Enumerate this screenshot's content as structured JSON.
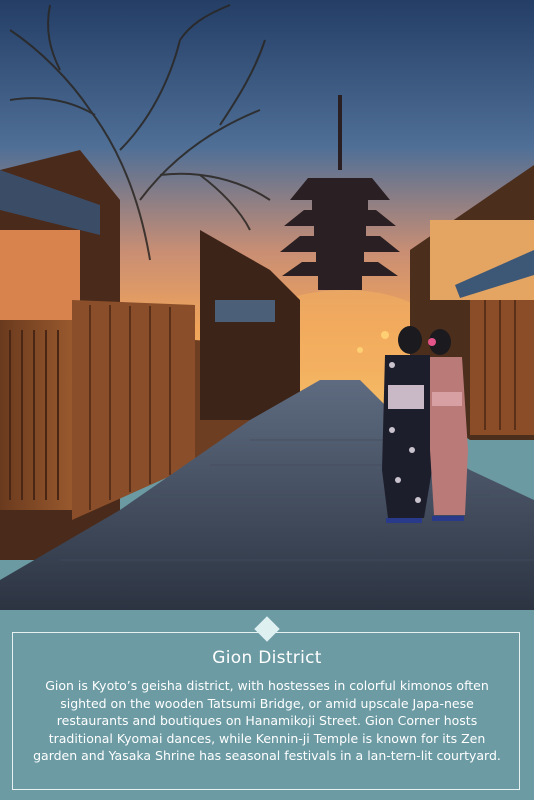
{
  "photo": {
    "subject": "Pagoda at dusk above a stone-paved lane lined with wooden houses; two women in kimonos stand on the street"
  },
  "decor": {
    "icon": "diamond-icon",
    "accent": "#dff0f1",
    "panel_color": "#6c9ba4"
  },
  "caption": {
    "title": "Gion District",
    "description": "Gion is Kyoto’s geisha district, with hostesses in colorful kimonos often sighted on the wooden Tatsumi Bridge, or amid upscale Japa-nese restaurants and boutiques on Hanamikoji Street. Gion Corner hosts traditional Kyomai dances, while Kennin-ji Temple is known for its Zen garden and Yasaka Shrine has seasonal festivals in a lan-tern-lit courtyard."
  }
}
